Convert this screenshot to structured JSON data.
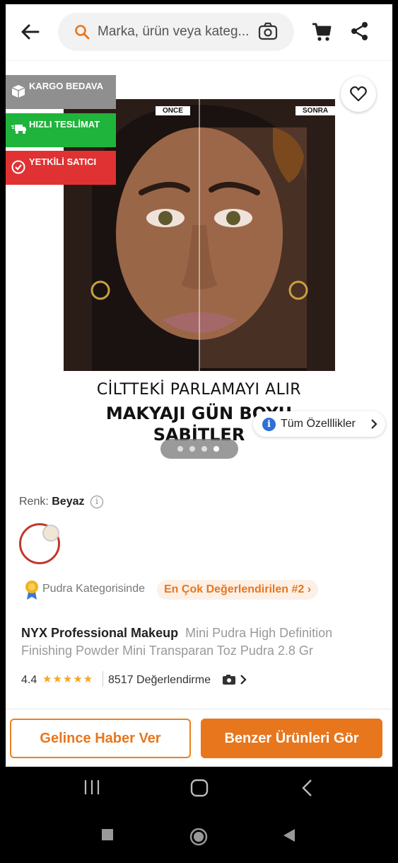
{
  "header": {
    "search_placeholder": "Marka, ürün veya kateg..."
  },
  "hero": {
    "before_label": "ONCE",
    "after_label": "SONRA",
    "caption_line1": "CİLTTEKİ PARLAMAYI ALIR",
    "caption_line2": "MAKYAJI GÜN BOYU",
    "caption_line3": "SABİTLER",
    "badges": [
      {
        "label": "KARGO BEDAVA",
        "color": "#8f8f8f"
      },
      {
        "label": "HIZLI TESLİMAT",
        "color": "#1fb43b"
      },
      {
        "label": "YETKİLİ SATICI",
        "color": "#e03232"
      }
    ]
  },
  "features_link": "Tüm Özelllikler",
  "color": {
    "label": "Renk:",
    "value": "Beyaz"
  },
  "ranking": {
    "label": "Pudra Kategorisinde",
    "pill": "En Çok Değerlendirilen #2"
  },
  "product": {
    "brand": "NYX Professional Makeup",
    "name": "Mini Pudra High Definition Finishing Powder Mini Transparan Toz Pudra 2.8 Gr"
  },
  "rating": {
    "score": "4.4",
    "stars": "★★★★★",
    "reviews": "8517 Değerlendirme"
  },
  "actions": {
    "notify": "Gelince Haber Ver",
    "similar": "Benzer Ürünleri Gör"
  },
  "colors": {
    "accent": "#e8761d",
    "badge_gray": "#8f8f8f",
    "badge_green": "#1fb43b",
    "badge_red": "#e03232"
  }
}
